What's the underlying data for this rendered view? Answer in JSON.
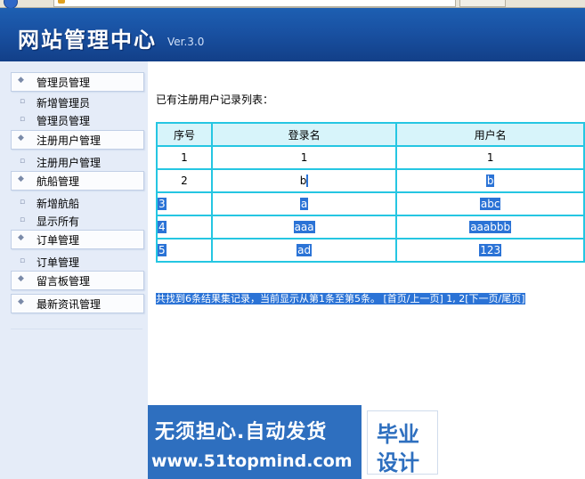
{
  "header": {
    "title": "网站管理中心",
    "version": "Ver.3.0"
  },
  "sidebar": {
    "groups": [
      {
        "label": "管理员管理",
        "items": [
          "新增管理员",
          "管理员管理"
        ]
      },
      {
        "label": "注册用户管理",
        "items": [
          "注册用户管理"
        ]
      },
      {
        "label": "航船管理",
        "items": [
          "新增航船",
          "显示所有"
        ]
      },
      {
        "label": "订单管理",
        "items": [
          "订单管理"
        ]
      },
      {
        "label": "留言板管理",
        "items": []
      },
      {
        "label": "最新资讯管理",
        "items": []
      }
    ]
  },
  "main": {
    "list_title": "已有注册用户记录列表：",
    "table": {
      "headers": [
        "序号",
        "登录名",
        "用户名"
      ],
      "rows": [
        [
          "1",
          "1",
          "1"
        ],
        [
          "2",
          "b",
          "b"
        ],
        [
          "3",
          "a",
          "abc"
        ],
        [
          "4",
          "aaa",
          "aaabbb"
        ],
        [
          "5",
          "ad",
          "123"
        ]
      ]
    },
    "pager": "共找到6条结果集记录，当前显示从第1条至第5条。 [首页/上一页] 1, 2[下一页/尾页]"
  },
  "watermark": {
    "line1": "无须担心.自动发货",
    "line2": "www.51topmind.com",
    "logo_line1": "毕业",
    "logo_line2": "设计"
  },
  "colors": {
    "header_blue": "#1951a2",
    "sidebar_bg": "#e5ecf8",
    "table_border": "#25c6e2",
    "selection_blue": "#2b73d6"
  }
}
